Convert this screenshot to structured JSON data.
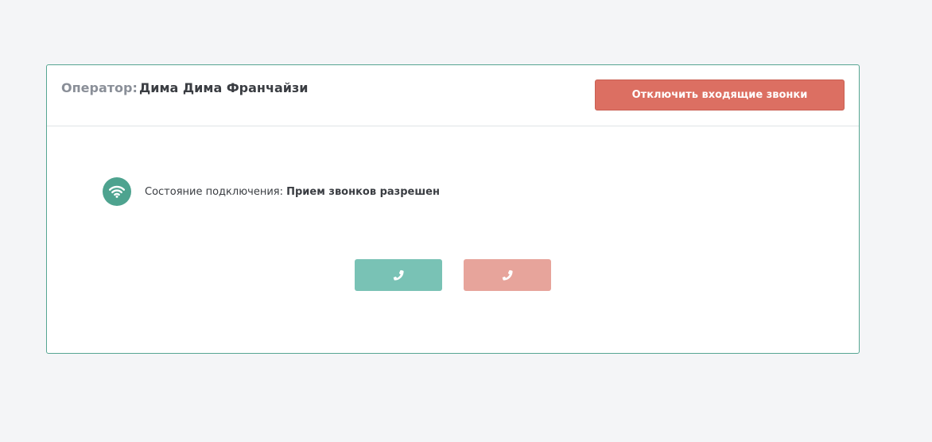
{
  "operator": {
    "label": "Оператор:",
    "name": "Дима Дима Франчайзи"
  },
  "disable_button": {
    "label": "Отключить входящие звонки",
    "color": "#dc6f62"
  },
  "connection": {
    "label": "Состояние подключения:",
    "value": "Прием звонков разрешен",
    "icon": "wifi-icon",
    "color": "#4ea38f"
  },
  "call_buttons": {
    "accept": {
      "icon": "phone-icon",
      "color": "#79c2b5"
    },
    "decline": {
      "icon": "phone-icon",
      "color": "#e7a49b"
    }
  }
}
